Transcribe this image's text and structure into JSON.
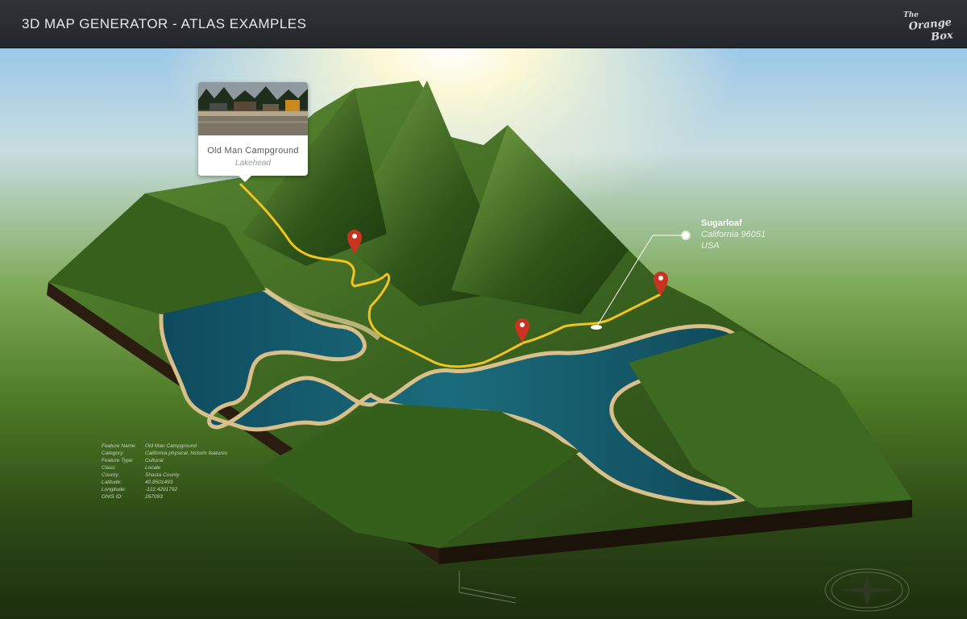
{
  "header": {
    "title": "3D MAP GENERATOR - ATLAS EXAMPLES",
    "logo_small": "The",
    "logo_main": "Orange Box"
  },
  "callout": {
    "name": "Old Man Campground",
    "subtitle": "Lakehead"
  },
  "place_label": {
    "name": "Sugarloaf",
    "line1": "California 96051",
    "line2": "USA"
  },
  "info": [
    {
      "key": "Feature Name:",
      "value": "Old Man Campground"
    },
    {
      "key": "Category:",
      "value": "California physical, historic features"
    },
    {
      "key": "Feature Type:",
      "value": "Cultural"
    },
    {
      "key": "Class:",
      "value": "Locale"
    },
    {
      "key": "County:",
      "value": "Shasta County"
    },
    {
      "key": "Latitude:",
      "value": "40.8501493"
    },
    {
      "key": "Longitude:",
      "value": "-122.4291792"
    },
    {
      "key": "GNIS ID:",
      "value": "267093"
    }
  ],
  "colors": {
    "route": "#f2c41c",
    "pin": "#c8341f",
    "water": "#15566a",
    "forest": "#3f6b22"
  },
  "icons": [
    "map-pin-icon",
    "compass-icon",
    "scale-bar-icon",
    "location-dot-icon"
  ]
}
